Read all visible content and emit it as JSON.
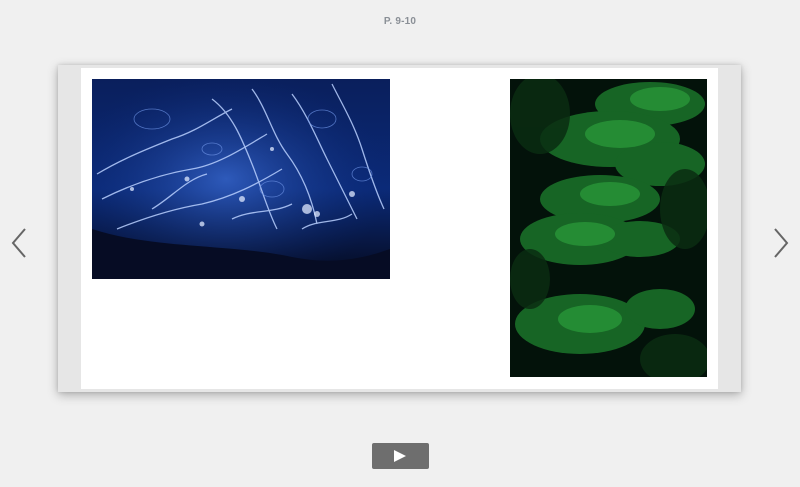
{
  "viewer": {
    "page_indicator": "P. 9-10"
  },
  "spread": {
    "left_page": {
      "image": {
        "subject": "blue-ice-closeup",
        "dominant_color": "#0b2a78"
      }
    },
    "right_page": {
      "image": {
        "subject": "green-foliage-dark",
        "dominant_color": "#1a7a2a"
      }
    }
  },
  "navigation": {
    "prev_icon": "chevron-left-icon",
    "next_icon": "chevron-right-icon"
  },
  "playback": {
    "icon": "play-icon"
  },
  "colors": {
    "background": "#f0f0f0",
    "page": "#ffffff",
    "play_button": "#6e6e6e",
    "arrow": "#666666"
  }
}
